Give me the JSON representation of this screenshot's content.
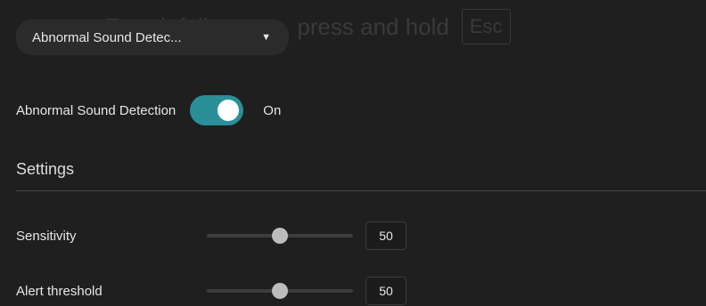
{
  "fullscreen_hint": {
    "text": "To exit full screen, press and hold",
    "key": "Esc"
  },
  "detection_dropdown": {
    "selected": "Abnormal Sound Detec...",
    "caret": "▼"
  },
  "detection_toggle": {
    "label": "Abnormal Sound Detection",
    "state_label": "On",
    "enabled": true,
    "accent_color": "#2a8f97"
  },
  "settings": {
    "title": "Settings",
    "sliders": [
      {
        "label": "Sensitivity",
        "value": "50",
        "level_percent": 50
      },
      {
        "label": "Alert threshold",
        "value": "50",
        "level_percent": 50
      }
    ]
  }
}
